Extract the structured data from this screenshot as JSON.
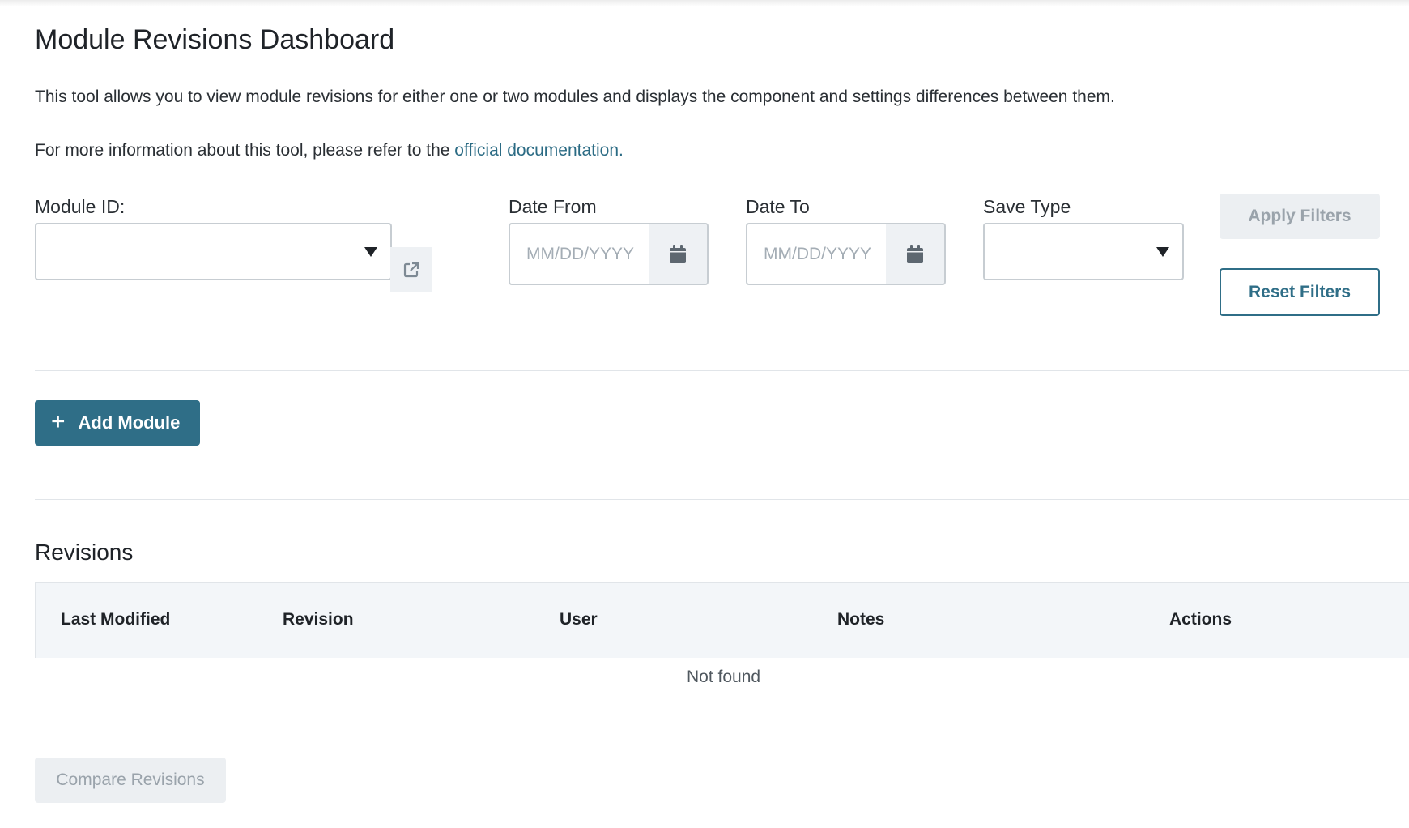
{
  "page": {
    "title": "Module Revisions Dashboard",
    "description": "This tool allows you to view module revisions for either one or two modules and displays the component and settings differences between them.",
    "more_info_prefix": "For more information about this tool, please refer to the ",
    "more_info_link": "official documentation."
  },
  "filters": {
    "module_id_label": "Module ID:",
    "module_id_value": "",
    "date_from_label": "Date From",
    "date_from_placeholder": "MM/DD/YYYY",
    "date_to_label": "Date To",
    "date_to_placeholder": "MM/DD/YYYY",
    "save_type_label": "Save Type",
    "save_type_value": "",
    "apply_label": "Apply Filters",
    "reset_label": "Reset Filters"
  },
  "actions": {
    "add_module_label": "Add Module",
    "add_module_icon": "plus-icon"
  },
  "revisions": {
    "title": "Revisions",
    "columns": [
      "Last Modified",
      "Revision",
      "User",
      "Notes",
      "Actions"
    ],
    "rows": [],
    "empty_message": "Not found"
  },
  "footer": {
    "compare_label": "Compare Revisions"
  },
  "colors": {
    "accent": "#2f6e87",
    "link": "#2b6b84",
    "disabled_bg": "#eceff2",
    "disabled_text": "#9aa3ab",
    "table_header_bg": "#f3f6f9"
  }
}
